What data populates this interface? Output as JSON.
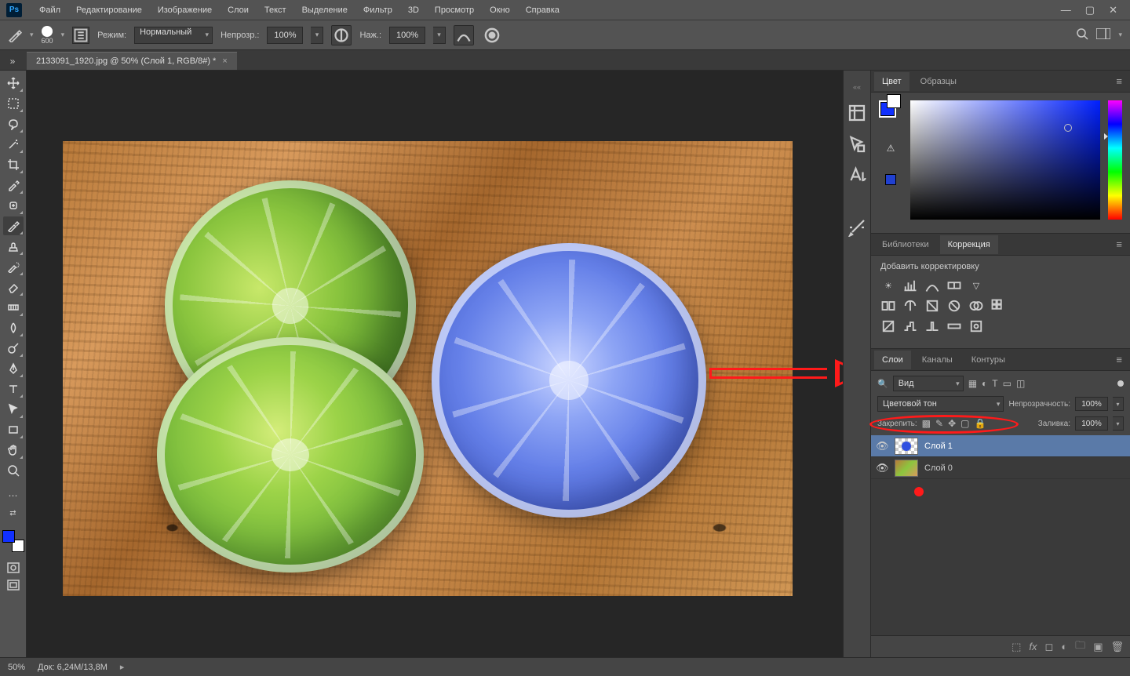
{
  "app": {
    "logo": "Ps"
  },
  "menu": [
    "Файл",
    "Редактирование",
    "Изображение",
    "Слои",
    "Текст",
    "Выделение",
    "Фильтр",
    "3D",
    "Просмотр",
    "Окно",
    "Справка"
  ],
  "options": {
    "brush_size": "600",
    "mode_label": "Режим:",
    "mode_value": "Нормальный",
    "opacity_label": "Непрозр.:",
    "opacity_value": "100%",
    "flow_label": "Наж.:",
    "flow_value": "100%"
  },
  "document": {
    "tab_title": "2133091_1920.jpg @ 50% (Слой 1, RGB/8#) *"
  },
  "panels": {
    "color_tabs": [
      "Цвет",
      "Образцы"
    ],
    "lib_tabs": [
      "Библиотеки",
      "Коррекция"
    ],
    "adjust_label": "Добавить корректировку",
    "layer_tabs": [
      "Слои",
      "Каналы",
      "Контуры"
    ],
    "layer_filter": "Вид",
    "blend_mode": "Цветовой тон",
    "opacity_label": "Непрозрачность:",
    "opacity_value": "100%",
    "lock_label": "Закрепить:",
    "fill_label": "Заливка:",
    "fill_value": "100%",
    "layers": [
      {
        "name": "Слой 1"
      },
      {
        "name": "Слой 0"
      }
    ]
  },
  "status": {
    "zoom": "50%",
    "doc_label": "Док:",
    "doc_size": "6,24M/13,8M"
  }
}
